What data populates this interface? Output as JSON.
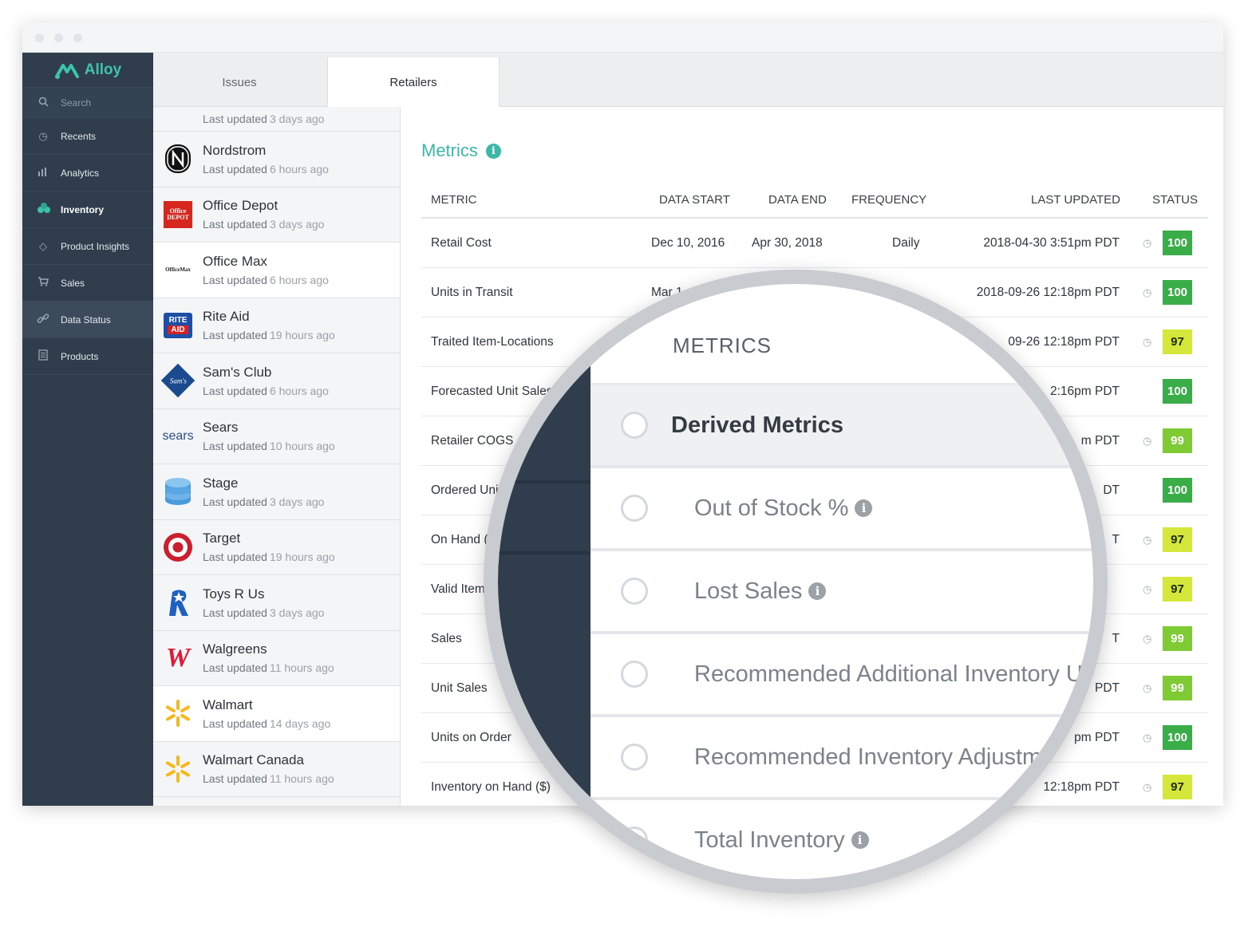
{
  "app": {
    "name": "Alloy",
    "brand_color": "#3cc3aa"
  },
  "sidebar": {
    "search_label": "Search",
    "items": [
      {
        "label": "Recents",
        "icon": "clock-icon"
      },
      {
        "label": "Analytics",
        "icon": "bar-chart-icon"
      },
      {
        "label": "Inventory",
        "icon": "boxes-icon",
        "active": true
      },
      {
        "label": "Product Insights",
        "icon": "diamond-icon"
      },
      {
        "label": "Sales",
        "icon": "cart-icon"
      },
      {
        "label": "Data Status",
        "icon": "link-icon"
      },
      {
        "label": "Products",
        "icon": "list-icon"
      }
    ]
  },
  "tabs": [
    {
      "label": "Issues"
    },
    {
      "label": "Retailers",
      "active": true
    }
  ],
  "retailers": {
    "top_partial": {
      "prefix": "Last updated",
      "ago": "3 days ago"
    },
    "items": [
      {
        "name": "Nordstrom",
        "prefix": "Last updated",
        "ago": "6 hours ago",
        "logo": "nordstrom-logo"
      },
      {
        "name": "Office Depot",
        "prefix": "Last updated",
        "ago": "3 days ago",
        "logo": "office-depot-logo"
      },
      {
        "name": "Office Max",
        "prefix": "Last updated",
        "ago": "6 hours ago",
        "logo": "office-max-logo"
      },
      {
        "name": "Rite Aid",
        "prefix": "Last updated",
        "ago": "19 hours ago",
        "logo": "rite-aid-logo"
      },
      {
        "name": "Sam's Club",
        "prefix": "Last updated",
        "ago": "6 hours ago",
        "logo": "sams-club-logo"
      },
      {
        "name": "Sears",
        "prefix": "Last updated",
        "ago": "10 hours ago",
        "logo": "sears-logo"
      },
      {
        "name": "Stage",
        "prefix": "Last updated",
        "ago": "3 days ago",
        "logo": "stage-logo"
      },
      {
        "name": "Target",
        "prefix": "Last updated",
        "ago": "19 hours ago",
        "logo": "target-logo"
      },
      {
        "name": "Toys R Us",
        "prefix": "Last updated",
        "ago": "3 days ago",
        "logo": "toys-r-us-logo"
      },
      {
        "name": "Walgreens",
        "prefix": "Last updated",
        "ago": "11 hours ago",
        "logo": "walgreens-logo"
      },
      {
        "name": "Walmart",
        "prefix": "Last updated",
        "ago": "14 days ago",
        "logo": "walmart-logo"
      },
      {
        "name": "Walmart Canada",
        "prefix": "Last updated",
        "ago": "11 hours ago",
        "logo": "walmart-logo"
      }
    ],
    "logo_text": {
      "office_depot": "Office DEPOT",
      "office_max": "OfficeMax",
      "rite_aid_top": "RITE",
      "rite_aid_bottom": "AID",
      "sams": "Sam's",
      "sears": "sears",
      "walgreens": "W"
    }
  },
  "metrics": {
    "title": "Metrics",
    "info": "i",
    "columns": {
      "metric": "METRIC",
      "data_start": "DATA START",
      "data_end": "DATA END",
      "frequency": "FREQUENCY",
      "last_updated": "LAST UPDATED",
      "status": "STATUS"
    },
    "rows": [
      {
        "metric": "Retail Cost",
        "start": "Dec 10, 2016",
        "end": "Apr 30, 2018",
        "freq": "Daily",
        "updated": "2018-04-30 3:51pm PDT",
        "clock": true,
        "status": "100"
      },
      {
        "metric": "Units in Transit",
        "start": "Mar 1",
        "end": "",
        "freq": "",
        "updated": "2018-09-26 12:18pm PDT",
        "clock": true,
        "status": "100"
      },
      {
        "metric": "Traited Item-Locations",
        "start": "",
        "end": "",
        "freq": "",
        "updated": "09-26 12:18pm PDT",
        "clock": true,
        "status": "97"
      },
      {
        "metric": "Forecasted Unit Sales",
        "start": "",
        "end": "",
        "freq": "",
        "updated": "2:16pm PDT",
        "clock": false,
        "status": "100"
      },
      {
        "metric": "Retailer COGS",
        "start": "",
        "end": "",
        "freq": "",
        "updated": "m PDT",
        "clock": true,
        "status": "99"
      },
      {
        "metric": "Ordered Uni",
        "start": "",
        "end": "",
        "freq": "",
        "updated": "DT",
        "clock": false,
        "status": "100"
      },
      {
        "metric": "On Hand (",
        "start": "",
        "end": "",
        "freq": "",
        "updated": "T",
        "clock": true,
        "status": "97"
      },
      {
        "metric": "Valid Item",
        "start": "",
        "end": "",
        "freq": "",
        "updated": "",
        "clock": true,
        "status": "97"
      },
      {
        "metric": "Sales",
        "start": "",
        "end": "",
        "freq": "",
        "updated": "T",
        "clock": true,
        "status": "99"
      },
      {
        "metric": "Unit Sales",
        "start": "",
        "end": "",
        "freq": "",
        "updated": "PDT",
        "clock": true,
        "status": "99"
      },
      {
        "metric": "Units on Order",
        "start": "",
        "end": "",
        "freq": "",
        "updated": "pm PDT",
        "clock": true,
        "status": "100"
      },
      {
        "metric": "Inventory on Hand ($)",
        "start": "",
        "end": "",
        "freq": "",
        "updated": "12:18pm PDT",
        "clock": true,
        "status": "97"
      }
    ],
    "status_colors": {
      "100": "#3aad48",
      "99": "#7ecb36",
      "97": "#d5e73a"
    }
  },
  "magnifier": {
    "heading": "METRICS",
    "rows": [
      {
        "label": "Derived Metrics",
        "selected": true,
        "info": false
      },
      {
        "label": "Out of Stock %",
        "selected": false,
        "info": true
      },
      {
        "label": "Lost Sales",
        "selected": false,
        "info": true
      },
      {
        "label": "Recommended Additional Inventory Units",
        "selected": false,
        "info": false
      },
      {
        "label": "Recommended Inventory Adjustment",
        "selected": false,
        "info": false
      },
      {
        "label": "Total Inventory",
        "selected": false,
        "info": true
      }
    ],
    "info_glyph": "i"
  }
}
